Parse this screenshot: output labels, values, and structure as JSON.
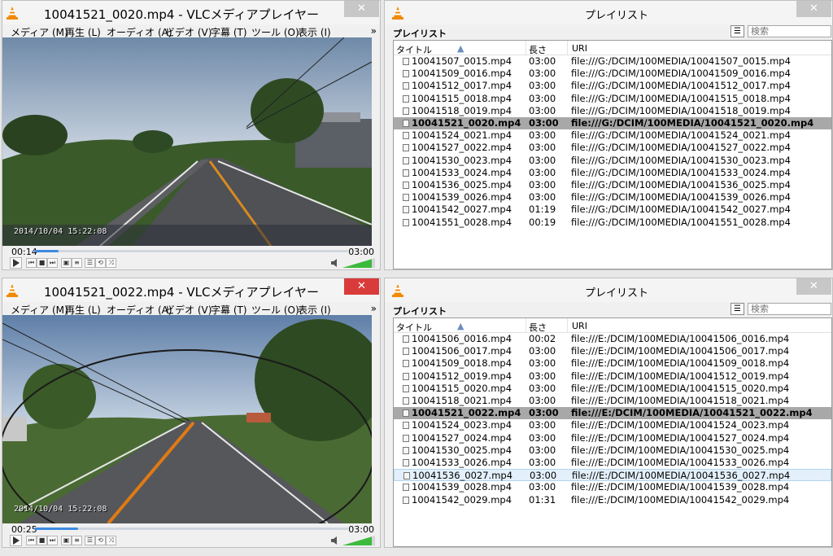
{
  "top_player": {
    "title": "10041521_0020.mp4 - VLCメディアプレイヤー",
    "close": "✕",
    "menu": [
      "メディア (M)",
      "再生 (L)",
      "オーディオ (A)",
      "ビデオ (V)",
      "字幕 (T)",
      "ツール (O)",
      "表示 (I)"
    ],
    "menu_more": "»",
    "osd": "2014/10/04  15:22:08",
    "elapsed": "00:14",
    "duration": "03:00",
    "progress": 0.078
  },
  "top_playlist": {
    "title": "プレイリスト",
    "close": "✕",
    "label": "プレイリスト",
    "search_placeholder": "検索",
    "columns": [
      "タイトル",
      "長さ",
      "URI"
    ],
    "rows": [
      {
        "title": "10041507_0015.mp4",
        "length": "03:00",
        "uri": "file:///G:/DCIM/100MEDIA/10041507_0015.mp4"
      },
      {
        "title": "10041509_0016.mp4",
        "length": "03:00",
        "uri": "file:///G:/DCIM/100MEDIA/10041509_0016.mp4"
      },
      {
        "title": "10041512_0017.mp4",
        "length": "03:00",
        "uri": "file:///G:/DCIM/100MEDIA/10041512_0017.mp4"
      },
      {
        "title": "10041515_0018.mp4",
        "length": "03:00",
        "uri": "file:///G:/DCIM/100MEDIA/10041515_0018.mp4"
      },
      {
        "title": "10041518_0019.mp4",
        "length": "03:00",
        "uri": "file:///G:/DCIM/100MEDIA/10041518_0019.mp4"
      },
      {
        "title": "10041521_0020.mp4",
        "length": "03:00",
        "uri": "file:///G:/DCIM/100MEDIA/10041521_0020.mp4",
        "current": true
      },
      {
        "title": "10041524_0021.mp4",
        "length": "03:00",
        "uri": "file:///G:/DCIM/100MEDIA/10041524_0021.mp4"
      },
      {
        "title": "10041527_0022.mp4",
        "length": "03:00",
        "uri": "file:///G:/DCIM/100MEDIA/10041527_0022.mp4"
      },
      {
        "title": "10041530_0023.mp4",
        "length": "03:00",
        "uri": "file:///G:/DCIM/100MEDIA/10041530_0023.mp4"
      },
      {
        "title": "10041533_0024.mp4",
        "length": "03:00",
        "uri": "file:///G:/DCIM/100MEDIA/10041533_0024.mp4"
      },
      {
        "title": "10041536_0025.mp4",
        "length": "03:00",
        "uri": "file:///G:/DCIM/100MEDIA/10041536_0025.mp4"
      },
      {
        "title": "10041539_0026.mp4",
        "length": "03:00",
        "uri": "file:///G:/DCIM/100MEDIA/10041539_0026.mp4"
      },
      {
        "title": "10041542_0027.mp4",
        "length": "01:19",
        "uri": "file:///G:/DCIM/100MEDIA/10041542_0027.mp4"
      },
      {
        "title": "10041551_0028.mp4",
        "length": "00:19",
        "uri": "file:///G:/DCIM/100MEDIA/10041551_0028.mp4"
      }
    ]
  },
  "bottom_player": {
    "title": "10041521_0022.mp4 - VLCメディアプレイヤー",
    "close": "✕",
    "menu": [
      "メディア (M)",
      "再生 (L)",
      "オーディオ (A)",
      "ビデオ (V)",
      "字幕 (T)",
      "ツール (O)",
      "表示 (I)"
    ],
    "menu_more": "»",
    "osd": "2014/10/04  15:22:08",
    "elapsed": "00:25",
    "duration": "03:00",
    "progress": 0.139
  },
  "bottom_playlist": {
    "title": "プレイリスト",
    "close": "✕",
    "label": "プレイリスト",
    "search_placeholder": "検索",
    "columns": [
      "タイトル",
      "長さ",
      "URI"
    ],
    "rows": [
      {
        "title": "10041506_0016.mp4",
        "length": "00:02",
        "uri": "file:///E:/DCIM/100MEDIA/10041506_0016.mp4"
      },
      {
        "title": "10041506_0017.mp4",
        "length": "03:00",
        "uri": "file:///E:/DCIM/100MEDIA/10041506_0017.mp4"
      },
      {
        "title": "10041509_0018.mp4",
        "length": "03:00",
        "uri": "file:///E:/DCIM/100MEDIA/10041509_0018.mp4"
      },
      {
        "title": "10041512_0019.mp4",
        "length": "03:00",
        "uri": "file:///E:/DCIM/100MEDIA/10041512_0019.mp4"
      },
      {
        "title": "10041515_0020.mp4",
        "length": "03:00",
        "uri": "file:///E:/DCIM/100MEDIA/10041515_0020.mp4"
      },
      {
        "title": "10041518_0021.mp4",
        "length": "03:00",
        "uri": "file:///E:/DCIM/100MEDIA/10041518_0021.mp4"
      },
      {
        "title": "10041521_0022.mp4",
        "length": "03:00",
        "uri": "file:///E:/DCIM/100MEDIA/10041521_0022.mp4",
        "current": true
      },
      {
        "title": "10041524_0023.mp4",
        "length": "03:00",
        "uri": "file:///E:/DCIM/100MEDIA/10041524_0023.mp4"
      },
      {
        "title": "10041527_0024.mp4",
        "length": "03:00",
        "uri": "file:///E:/DCIM/100MEDIA/10041527_0024.mp4"
      },
      {
        "title": "10041530_0025.mp4",
        "length": "03:00",
        "uri": "file:///E:/DCIM/100MEDIA/10041530_0025.mp4"
      },
      {
        "title": "10041533_0026.mp4",
        "length": "03:00",
        "uri": "file:///E:/DCIM/100MEDIA/10041533_0026.mp4"
      },
      {
        "title": "10041536_0027.mp4",
        "length": "03:00",
        "uri": "file:///E:/DCIM/100MEDIA/10041536_0027.mp4",
        "selected": true
      },
      {
        "title": "10041539_0028.mp4",
        "length": "03:00",
        "uri": "file:///E:/DCIM/100MEDIA/10041539_0028.mp4"
      },
      {
        "title": "10041542_0029.mp4",
        "length": "01:31",
        "uri": "file:///E:/DCIM/100MEDIA/10041542_0029.mp4"
      }
    ]
  },
  "icons": {
    "app": "vlc-cone-icon",
    "play": "play-icon",
    "stop": "stop-icon",
    "prev": "previous-icon",
    "next": "next-icon",
    "fullscreen": "fullscreen-icon",
    "effects": "equalizer-icon",
    "playlist": "playlist-icon",
    "loop": "loop-icon",
    "shuffle": "shuffle-icon",
    "volume": "speaker-icon",
    "item": "media-file-icon",
    "view": "view-mode-icon"
  },
  "colors": {
    "accent": "#3d8ae0",
    "close_active": "#d93b3b",
    "current_row": "#a8a8a8",
    "selected_row": "#e3f0fb",
    "volume": "#3cba3c"
  }
}
